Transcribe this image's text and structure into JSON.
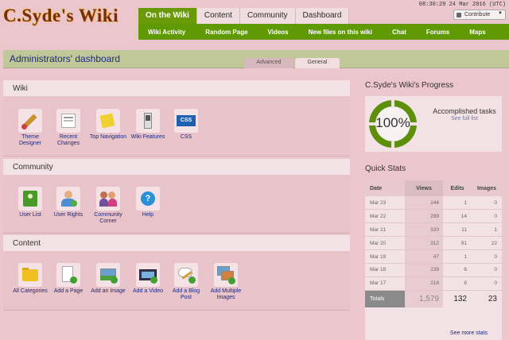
{
  "logo": "C.Syde's Wiki",
  "clock": "08:30:29 24 Mar 2016 (UTC)",
  "contribute_label": "Contribute",
  "nav": {
    "tabs": [
      "On the Wiki",
      "Content",
      "Community",
      "Dashboard"
    ],
    "sub": [
      "Wiki Activity",
      "Random Page",
      "Videos",
      "New files on this wiki",
      "Chat",
      "Forums",
      "Maps"
    ]
  },
  "page_title": "Administrators' dashboard",
  "view_tabs": [
    "Advanced",
    "General"
  ],
  "sections": {
    "wiki": {
      "title": "Wiki",
      "tools": [
        "Theme Designer",
        "Recent Changes",
        "Top Navigation",
        "Wiki Features",
        "CSS"
      ]
    },
    "community": {
      "title": "Community",
      "tools": [
        "User List",
        "User Rights",
        "Community Corner",
        "Help"
      ]
    },
    "content": {
      "title": "Content",
      "tools": [
        "All Categories",
        "Add a Page",
        "Add an Image",
        "Add a Video",
        "Add a Blog Post",
        "Add Multiple Images"
      ]
    }
  },
  "icons": {
    "wiki": [
      "paintbrush-icon",
      "news-icon",
      "sticky-note-icon",
      "toggle-switch-icon",
      "css-icon"
    ],
    "community": [
      "user-list-icon",
      "user-rights-icon",
      "community-corner-icon",
      "help-icon"
    ],
    "content": [
      "folder-icon",
      "add-page-icon",
      "add-image-icon",
      "add-video-icon",
      "add-blog-post-icon",
      "add-multiple-images-icon"
    ]
  },
  "css_icon_text": "CSS",
  "progress": {
    "title": "C.Syde's Wiki's Progress",
    "percent_label": "100%",
    "percent": 100,
    "accomplished": "Accomplished tasks",
    "see_full_list": "See full list"
  },
  "quick_stats": {
    "title": "Quick Stats",
    "headers": [
      "Date",
      "Views",
      "Edits",
      "Images"
    ],
    "rows": [
      [
        "Mar 23",
        "144",
        "1",
        "0"
      ],
      [
        "Mar 22",
        "299",
        "14",
        "0"
      ],
      [
        "Mar 21",
        "320",
        "11",
        "1"
      ],
      [
        "Mar 20",
        "312",
        "91",
        "22"
      ],
      [
        "Mar 19",
        "47",
        "1",
        "0"
      ],
      [
        "Mar 18",
        "239",
        "6",
        "0"
      ],
      [
        "Mar 17",
        "218",
        "8",
        "0"
      ]
    ],
    "totals": [
      "Totals",
      "1,579",
      "132",
      "23"
    ],
    "see_more": "See more stats"
  },
  "colors": {
    "background": "#ecc6cd",
    "nav_green": "#5f9a05",
    "ring_green": "#5e8f0a",
    "link": "#1a2a80"
  }
}
